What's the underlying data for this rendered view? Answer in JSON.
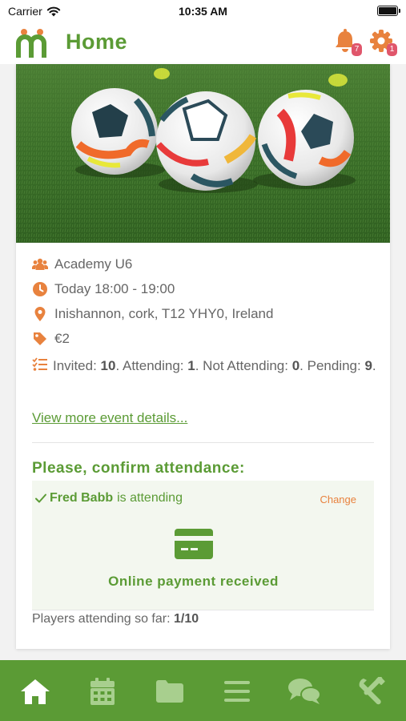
{
  "status_bar": {
    "carrier": "Carrier",
    "time": "10:35 AM"
  },
  "header": {
    "title": "Home",
    "notifications_count": "7",
    "settings_count": "1"
  },
  "event": {
    "team": "Academy U6",
    "time": "Today 18:00 - 19:00",
    "location": "Inishannon, cork, T12 YHY0, Ireland",
    "price": "€2",
    "stats": {
      "invited_label": "Invited: ",
      "invited": "10",
      "attending_label": ". Attending: ",
      "attending": "1",
      "not_attending_label": ". Not Attending: ",
      "not_attending": "0",
      "pending_label": ". Pending: ",
      "pending": "9",
      "end": "."
    },
    "more_link": "View more event details..."
  },
  "attendance": {
    "title": "Please, confirm attendance:",
    "player_name": "Fred Babb",
    "status": "is attending",
    "change_label": "Change",
    "payment_text": "Online payment received",
    "players_label": "Players attending so far: ",
    "players_count": "1/10"
  },
  "tabs": [
    "home-icon",
    "calendar-icon",
    "folder-icon",
    "menu-icon",
    "chat-icon",
    "tools-icon"
  ],
  "colors": {
    "brand_green": "#5b9b35",
    "accent_orange": "#e8823e",
    "badge_red": "#e0566b"
  }
}
